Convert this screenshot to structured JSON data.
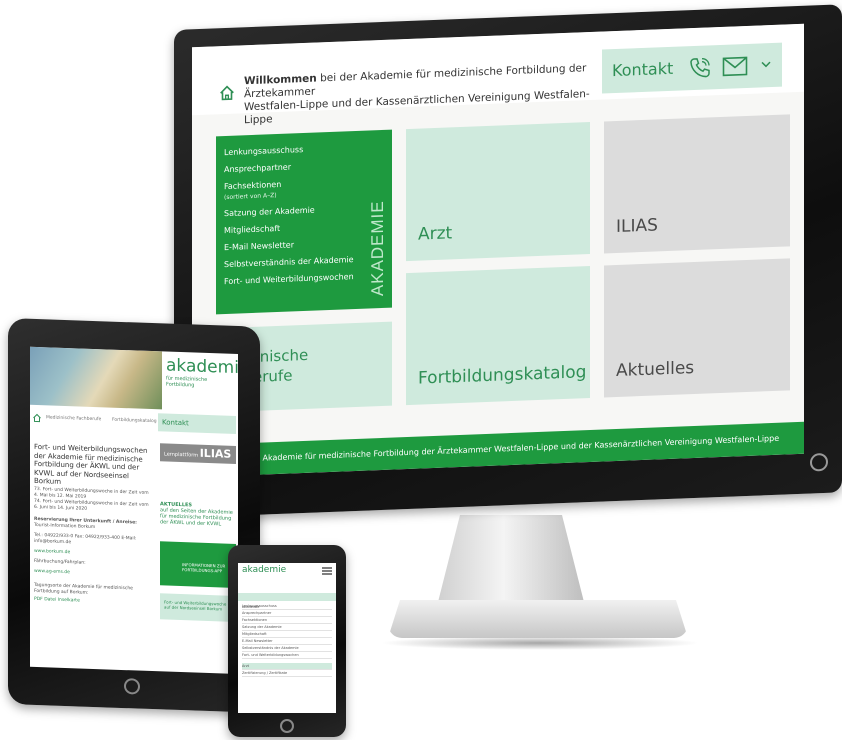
{
  "monitor": {
    "welcome_bold": "Willkommen",
    "welcome_rest": " bei der Akademie für medizinische Fortbildung der Ärztekammer",
    "welcome_line2": "Westfalen-Lippe und der Kassenärztlichen Vereinigung Westfalen-Lippe",
    "contact_label": "Kontakt",
    "menu_vertical_title": "AKADEMIE",
    "menu_items": [
      "Lenkungsausschuss",
      "Ansprechpartner",
      "Fachsektionen",
      "Satzung der Akademie",
      "Mitgliedschaft",
      "E-Mail Newsletter",
      "Selbstverständnis der Akademie",
      "Fort- und Weiterbildungswochen"
    ],
    "menu_sub_fachsektionen": "(sortiert von A–Z)",
    "tiles": {
      "arzt": "Arzt",
      "ilias": "ILIAS",
      "katalog": "Fortbildungskatalog",
      "aktuelles": "Aktuelles",
      "mfb_line1": "dizinische",
      "mfb_line2": "hberufe"
    },
    "footer": "© Akademie für medizinische Fortbildung der Ärztekammer Westfalen-Lippe und der Kassenärztlichen Vereinigung Westfalen-Lippe"
  },
  "tablet": {
    "logo_main": "akademie",
    "logo_sub": "für medizinische Fortbildung",
    "nav_left": "Medizinische Fachberufe",
    "nav_right": "Fortbildungskatalog",
    "contact_label": "Kontakt",
    "title": "Fort- und Weiterbildungswochen der Akademie für medizinische Fortbildung der ÄKWL und der KVWL auf der Nordseeinsel Borkum",
    "body_lines": [
      "73. Fort- und Weiterbildungswoche in der Zeit vom 4. Mai bis 12. Mai 2019",
      "74. Fort- und Weiterbildungswoche in der Zeit vom 6. Juni bis 14. Juni 2020",
      "Reservierung Ihrer Unterkunft / Anreise:",
      "Tourist-Information Borkum",
      "Tel.: 04922/933-0  Fax: 04922/933-400  E-Mail: info@borkum.de"
    ],
    "link1": "www.borkum.de",
    "body_line_after": "Fährbuchung/Fahrplan:",
    "link2": "www.ag-ems.de",
    "bottom_title": "Tagungsorte der Akademie für medizinische Fortbildung auf Borkum:",
    "pdf_link": "PDF Datei Inselkarte",
    "ilias_label": "Lernplattform",
    "ilias_brand": "ILIAS",
    "aktuelles_title": "AKTUELLES",
    "aktuelles_text": "auf den Seiten der Akademie für medizinische Fortbildung der ÄKWL und der KVWL",
    "app_text": "INFORMATIONEN ZUR FORTBILDUNGS-APP",
    "weeks_text": "Fort- und Weiterbildungswoche auf der Nordseeinsel Borkum"
  },
  "phone": {
    "logo": "akademie",
    "section_label": "Akademie",
    "items": [
      "Lenkungsausschuss",
      "Ansprechpartner",
      "Fachsektionen",
      "Satzung der Akademie",
      "Mitgliedschaft",
      "E-Mail Newsletter",
      "Selbstverständnis der Akademie",
      "Fort- und Weiterbildungswochen"
    ],
    "footer_items": [
      "Arzt",
      "Zertifizierung / Zertifikate"
    ]
  },
  "colors": {
    "accent_green": "#1e9a3f",
    "light_green": "#cfeadd",
    "tile_grey": "#dcdcdc"
  }
}
